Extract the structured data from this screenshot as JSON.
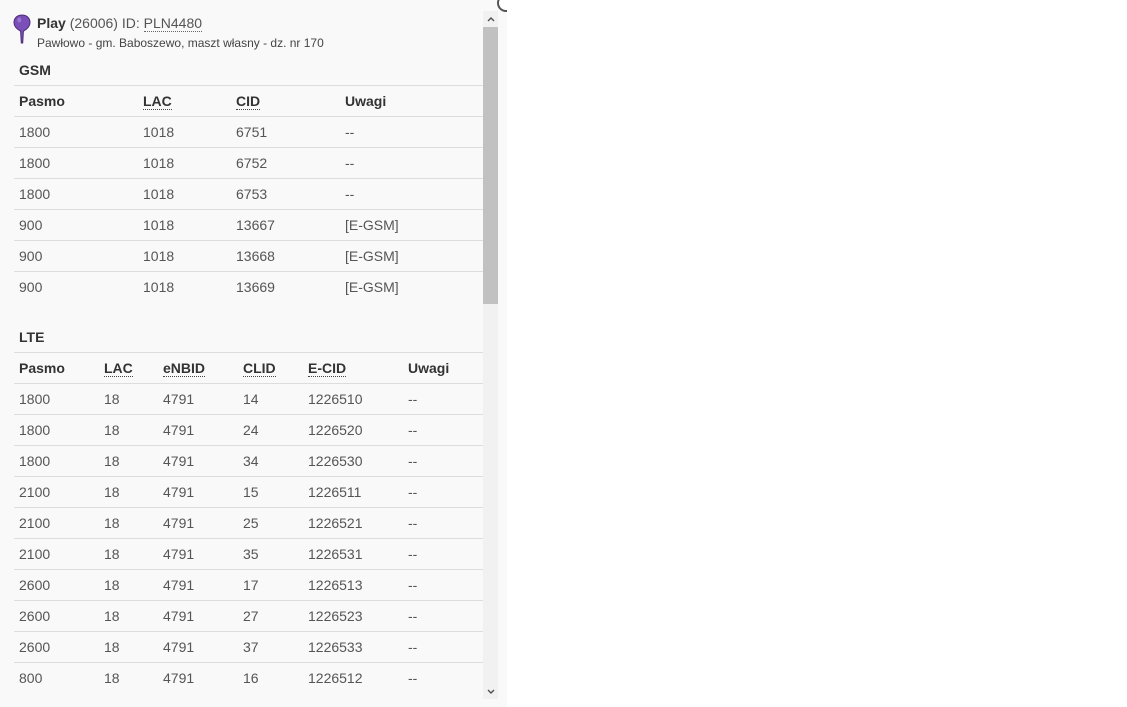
{
  "header": {
    "operator": "Play",
    "network_code": "(26006)",
    "id_label": "ID:",
    "station_id": "PLN4480",
    "location": "Pawłowo - gm. Baboszewo, maszt własny - dz. nr 170",
    "pin_color": "#7b4fb8"
  },
  "gsm": {
    "title": "GSM",
    "columns": [
      "Pasmo",
      "LAC",
      "CID",
      "Uwagi"
    ],
    "rows": [
      [
        "1800",
        "1018",
        "6751",
        "--"
      ],
      [
        "1800",
        "1018",
        "6752",
        "--"
      ],
      [
        "1800",
        "1018",
        "6753",
        "--"
      ],
      [
        "900",
        "1018",
        "13667",
        "[E-GSM]"
      ],
      [
        "900",
        "1018",
        "13668",
        "[E-GSM]"
      ],
      [
        "900",
        "1018",
        "13669",
        "[E-GSM]"
      ]
    ]
  },
  "lte": {
    "title": "LTE",
    "columns": [
      "Pasmo",
      "LAC",
      "eNBID",
      "CLID",
      "E-CID",
      "Uwagi"
    ],
    "rows": [
      [
        "1800",
        "18",
        "4791",
        "14",
        "1226510",
        "--"
      ],
      [
        "1800",
        "18",
        "4791",
        "24",
        "1226520",
        "--"
      ],
      [
        "1800",
        "18",
        "4791",
        "34",
        "1226530",
        "--"
      ],
      [
        "2100",
        "18",
        "4791",
        "15",
        "1226511",
        "--"
      ],
      [
        "2100",
        "18",
        "4791",
        "25",
        "1226521",
        "--"
      ],
      [
        "2100",
        "18",
        "4791",
        "35",
        "1226531",
        "--"
      ],
      [
        "2600",
        "18",
        "4791",
        "17",
        "1226513",
        "--"
      ],
      [
        "2600",
        "18",
        "4791",
        "27",
        "1226523",
        "--"
      ],
      [
        "2600",
        "18",
        "4791",
        "37",
        "1226533",
        "--"
      ],
      [
        "800",
        "18",
        "4791",
        "16",
        "1226512",
        "--"
      ]
    ]
  }
}
